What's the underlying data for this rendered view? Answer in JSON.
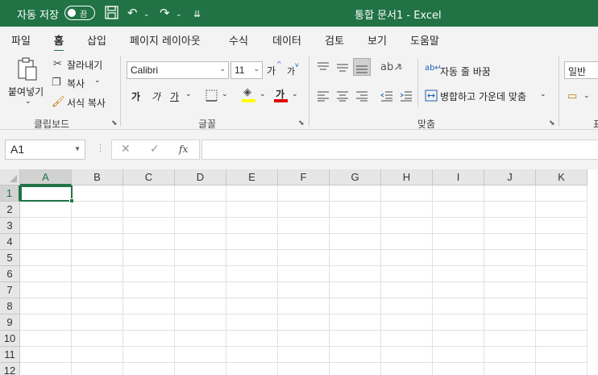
{
  "titlebar": {
    "autosave_label": "자동 저장",
    "autosave_state": "끔",
    "save_icon": "💾",
    "undo_icon": "↶",
    "redo_icon": "↷",
    "customize_icon": "⇊",
    "document_title": "통합 문서1  -  Excel"
  },
  "menu": {
    "tabs": [
      "파일",
      "홈",
      "삽입",
      "페이지 레이아웃",
      "수식",
      "데이터",
      "검토",
      "보기",
      "도움말"
    ],
    "active": "홈"
  },
  "ribbon": {
    "clipboard": {
      "paste_label": "붙여넣기",
      "cut_label": "잘라내기",
      "copy_label": "복사",
      "format_painter_label": "서식 복사",
      "group_label": "클립보드"
    },
    "font": {
      "font_name": "Calibri",
      "font_size": "11",
      "increase_size": "가",
      "decrease_size": "가",
      "bold": "가",
      "italic": "가",
      "underline": "가",
      "font_color_glyph": "가",
      "group_label": "글꼴"
    },
    "alignment": {
      "wrap_text_label": "자동 줄 바꿈",
      "merge_center_label": "병합하고 가운데 맞춤",
      "group_label": "맞춤"
    },
    "number": {
      "format_value": "일반",
      "group_label_partial": "표"
    }
  },
  "formula_bar": {
    "name_box": "A1",
    "cancel_icon": "✕",
    "enter_icon": "✓",
    "fx_label": "fx",
    "formula_value": ""
  },
  "grid": {
    "columns": [
      "A",
      "B",
      "C",
      "D",
      "E",
      "F",
      "G",
      "H",
      "I",
      "J",
      "K"
    ],
    "rows": [
      "1",
      "2",
      "3",
      "4",
      "5",
      "6",
      "7",
      "8",
      "9",
      "10",
      "11",
      "12"
    ],
    "selected_cell": "A1"
  },
  "colors": {
    "accent": "#217346",
    "ribbon_bg": "#f3f3f3",
    "font_color_bar": "#e00000",
    "highlight_bar": "#ffff00"
  }
}
